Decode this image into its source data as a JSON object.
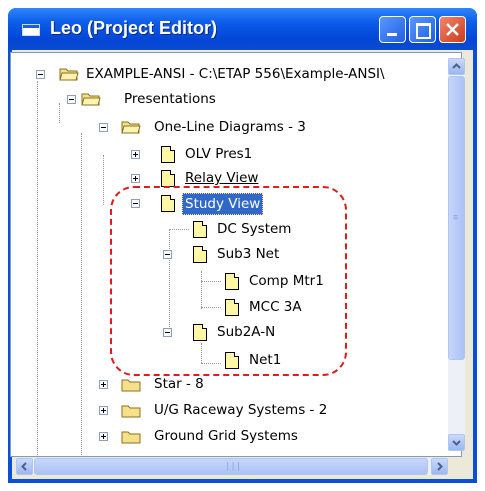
{
  "window": {
    "title": "Leo (Project Editor)"
  },
  "tree": {
    "root": "EXAMPLE-ANSI - C:\\ETAP 556\\Example-ANSI\\",
    "presentations": "Presentations",
    "one_line_diagrams": "One-Line Diagrams - 3",
    "olv_pres1": "OLV Pres1",
    "relay_view": "Relay View",
    "study_view": "Study View",
    "dc_system": "DC System",
    "sub3_net": "Sub3 Net",
    "comp_mtr1": "Comp Mtr1",
    "mcc_3a": "MCC 3A",
    "sub2a_n": "Sub2A-N",
    "net1": "Net1",
    "star": "Star - 8",
    "ug_raceway": "U/G Raceway Systems - 2",
    "ground_grid": "Ground Grid Systems"
  },
  "colors": {
    "selection": "#3169c6",
    "annotation": "#e01c1c",
    "titlebar": "#0b5ce8"
  }
}
